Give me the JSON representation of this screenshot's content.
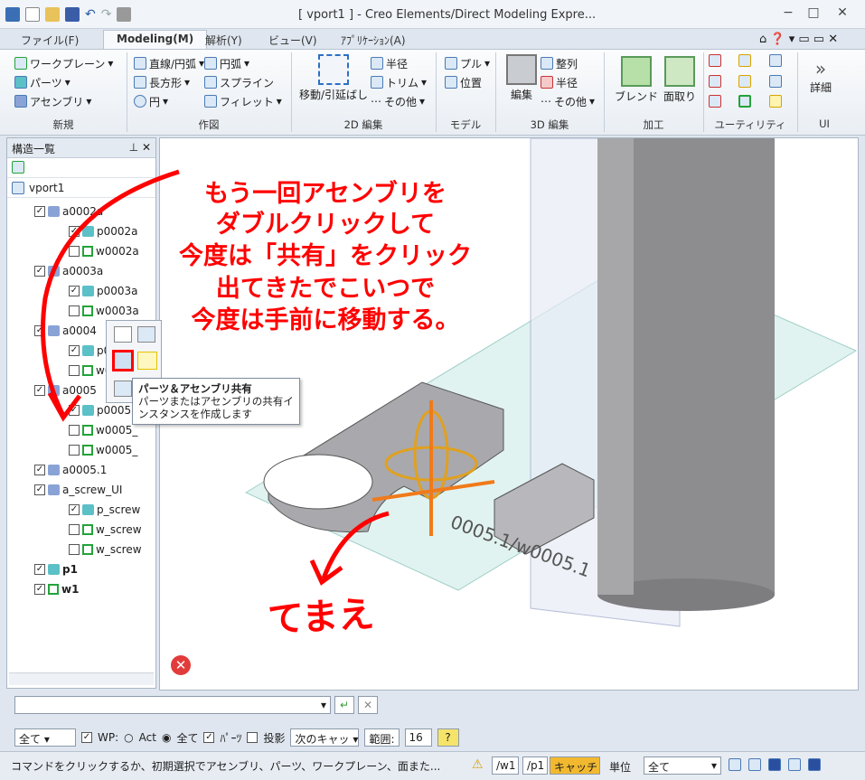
{
  "window": {
    "title": "[ vport1 ] - Creo Elements/Direct Modeling Expre..."
  },
  "tabs": [
    "ファイル(F)",
    "Modeling(M)",
    "解析(Y)",
    "ビュー(V)",
    "ｱﾌﾟﾘｹｰｼｮﾝ(A)"
  ],
  "ribbon": {
    "groups": [
      "新規",
      "作図",
      "2D 編集",
      "モデル",
      "3D 編集",
      "加工",
      "ユーティリティ",
      "UI"
    ],
    "new": {
      "workplane": "ワークプレーン",
      "parts": "パーツ",
      "assembly": "アセンブリ"
    },
    "draw": {
      "line_arc": "直線/円弧",
      "arc": "円弧",
      "rectangle": "長方形",
      "spline": "スプライン",
      "circle": "円",
      "fillet": "フィレット"
    },
    "edit2d": {
      "move_stretch": "移動/引延ばし",
      "radius": "半径",
      "trim": "トリム",
      "other": "その他"
    },
    "model": {
      "pull": "プル",
      "position": "位置"
    },
    "edit3d": {
      "edit": "編集",
      "align": "整列",
      "radius": "半径",
      "other": "その他"
    },
    "process": {
      "blend": "ブレンド",
      "chamfer": "面取り"
    },
    "ui": {
      "detail": "詳細"
    }
  },
  "panel": {
    "title": "構造一覧",
    "viewport_name": "vport1",
    "tree": [
      {
        "label": "a0002a",
        "checked": true,
        "type": "assembly"
      },
      {
        "label": "p0002a",
        "checked": true,
        "type": "part"
      },
      {
        "label": "w0002a",
        "checked": false,
        "type": "workplane"
      },
      {
        "label": "a0003a",
        "checked": true,
        "type": "assembly"
      },
      {
        "label": "p0003a",
        "checked": true,
        "type": "part"
      },
      {
        "label": "w0003a",
        "checked": false,
        "type": "workplane"
      },
      {
        "label": "a0004",
        "checked": true,
        "type": "assembly"
      },
      {
        "label": "p0004",
        "checked": true,
        "type": "part"
      },
      {
        "label": "w0004",
        "checked": false,
        "type": "workplane"
      },
      {
        "label": "a0005",
        "checked": true,
        "type": "assembly"
      },
      {
        "label": "p0005",
        "checked": true,
        "type": "part"
      },
      {
        "label": "w0005_",
        "checked": false,
        "type": "workplane"
      },
      {
        "label": "w0005_",
        "checked": false,
        "type": "workplane"
      },
      {
        "label": "a0005.1",
        "checked": true,
        "type": "assembly"
      },
      {
        "label": "a_screw_UI",
        "checked": true,
        "type": "assembly"
      },
      {
        "label": "p_screw",
        "checked": true,
        "type": "part"
      },
      {
        "label": "w_screw",
        "checked": false,
        "type": "workplane"
      },
      {
        "label": "w_screw",
        "checked": false,
        "type": "workplane"
      },
      {
        "label": "p1",
        "checked": true,
        "type": "part"
      },
      {
        "label": "w1",
        "checked": true,
        "type": "workplane"
      }
    ]
  },
  "tooltip": {
    "title": "パーツ＆アセンブリ共有",
    "body": "パーツまたはアセンブリの共有インスタンスを作成します"
  },
  "annotations": {
    "line1": "もう一回アセンブリを",
    "line2": "ダブルクリックして",
    "line3": "今度は「共有」をクリック",
    "line4": "出てきたでこいつで",
    "line5": "今度は手前に移動する。",
    "front": "てまえ"
  },
  "viewport_label": "0005.1/w0005.1",
  "cmdbar": {
    "filter": "全て",
    "wp_label": "WP:",
    "act": "Act",
    "all": "全て",
    "parts": "ﾊﾟｰﾂ",
    "projection": "投影",
    "next_catch": "次のキャッ",
    "range_label": "範囲:",
    "range_value": "16"
  },
  "status": {
    "message": "コマンドをクリックするか、初期選択でアセンブリ、パーツ、ワークプレーン、面また...",
    "wp": "/w1",
    "part": "/p1",
    "catch": "キャッチ",
    "unit_label": "単位",
    "unit_value": "全て"
  }
}
